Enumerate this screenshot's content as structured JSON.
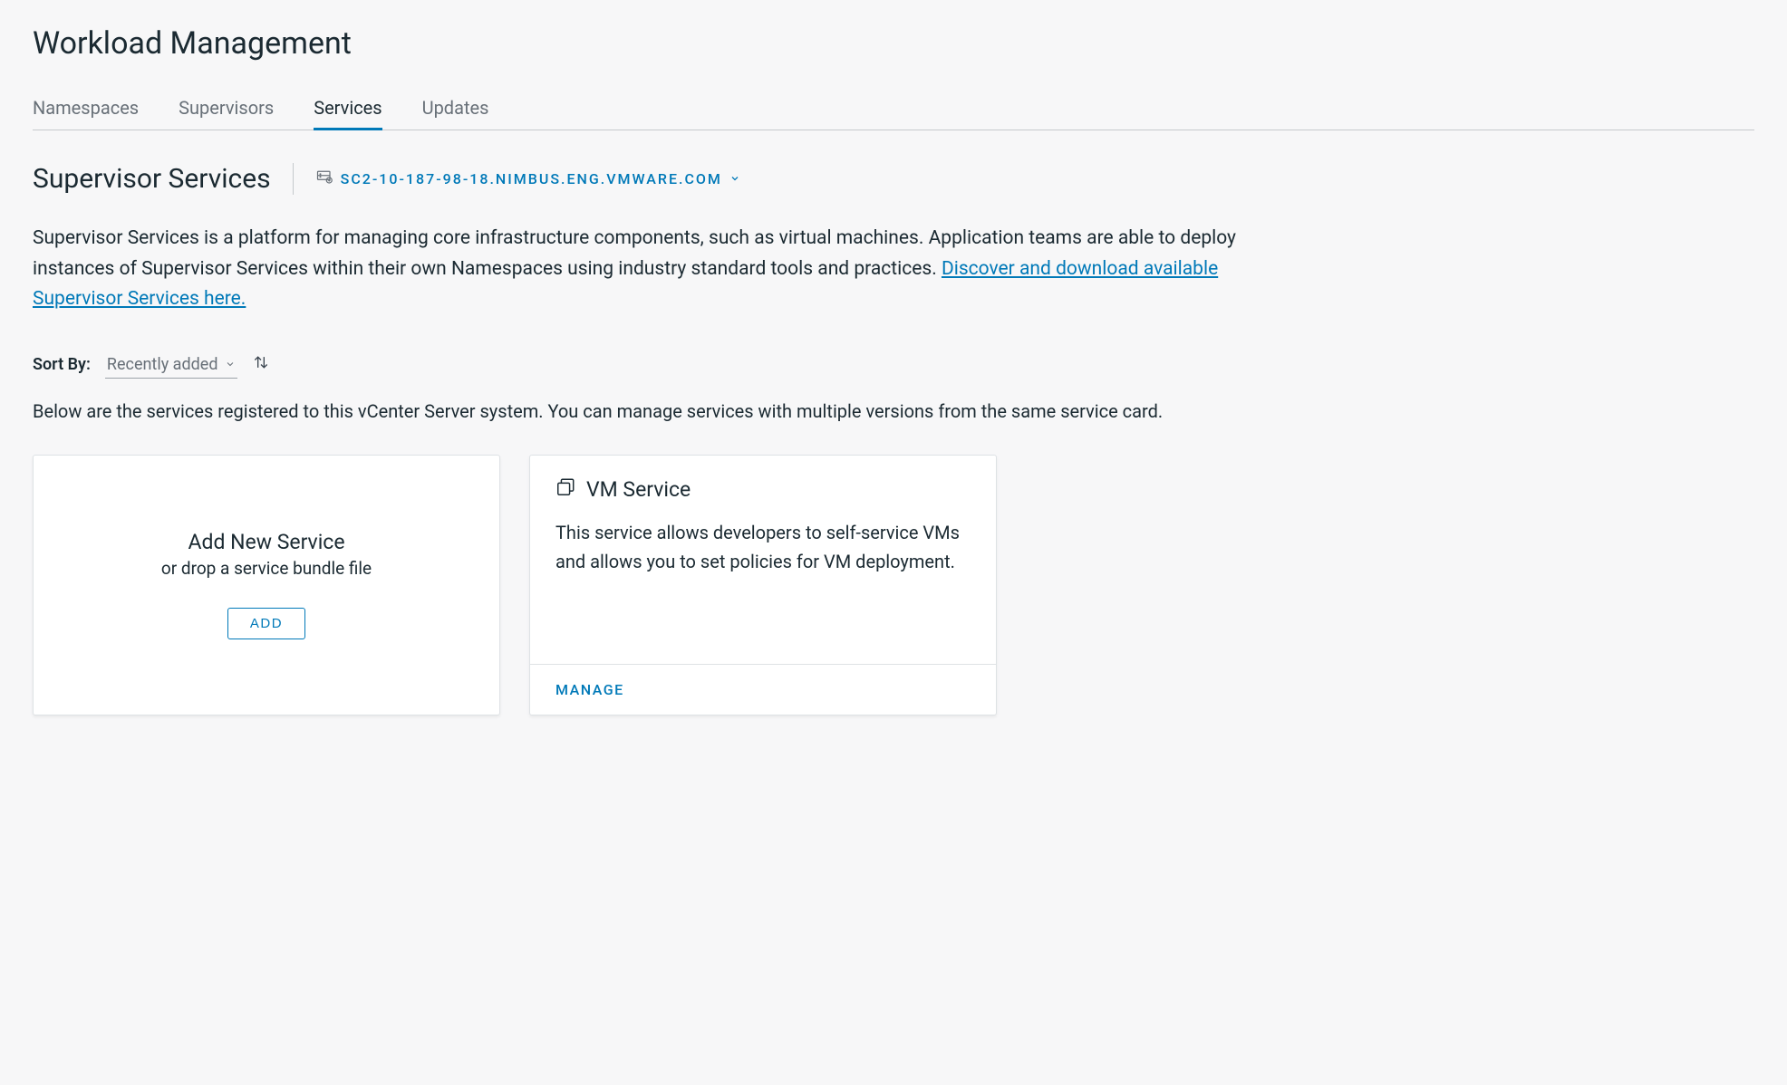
{
  "page": {
    "title": "Workload Management"
  },
  "tabs": [
    {
      "label": "Namespaces"
    },
    {
      "label": "Supervisors"
    },
    {
      "label": "Services"
    },
    {
      "label": "Updates"
    }
  ],
  "subheader": {
    "title": "Supervisor Services",
    "server": "SC2-10-187-98-18.NIMBUS.ENG.VMWARE.COM"
  },
  "description": {
    "text_before_link": "Supervisor Services is a platform for managing core infrastructure components, such as virtual machines. Application teams are able to deploy instances of Supervisor Services within their own Namespaces using industry standard tools and practices. ",
    "link_text": "Discover and download available Supervisor Services here."
  },
  "sort": {
    "label": "Sort By:",
    "selected": "Recently added"
  },
  "sub_description": "Below are the services registered to this vCenter Server system. You can manage services with multiple versions from the same service card.",
  "add_card": {
    "title": "Add New Service",
    "subtitle": "or drop a service bundle file",
    "button": "ADD"
  },
  "service_card": {
    "title": "VM Service",
    "description": "This service allows developers to self-service VMs and allows you to set policies for VM deployment.",
    "manage": "MANAGE"
  }
}
